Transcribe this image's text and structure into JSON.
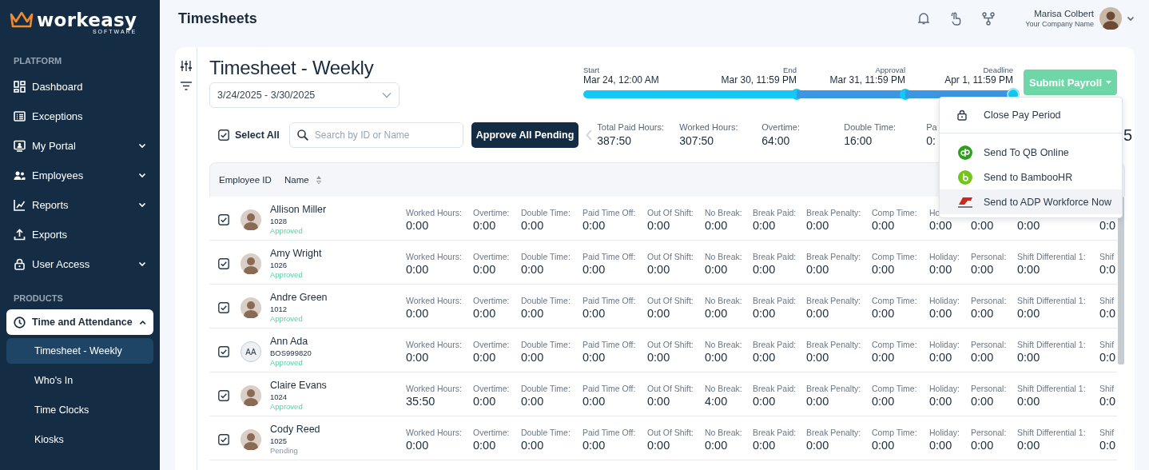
{
  "brand": {
    "name": "workeasy",
    "tagline": "SOFTWARE"
  },
  "sidebar": {
    "sections": [
      {
        "title": "PLATFORM",
        "items": [
          {
            "label": "Dashboard",
            "expandable": false
          },
          {
            "label": "Exceptions",
            "expandable": false
          },
          {
            "label": "My Portal",
            "expandable": true,
            "expanded": false
          },
          {
            "label": "Employees",
            "expandable": true,
            "expanded": false
          },
          {
            "label": "Reports",
            "expandable": true,
            "expanded": false
          },
          {
            "label": "Exports",
            "expandable": false
          },
          {
            "label": "User Access",
            "expandable": true,
            "expanded": false
          }
        ]
      },
      {
        "title": "PRODUCTS",
        "items": [
          {
            "label": "Time and Attendance",
            "expandable": true,
            "expanded": true,
            "children": [
              {
                "label": "Timesheet - Weekly",
                "selected": true
              },
              {
                "label": "Who's In",
                "selected": false
              },
              {
                "label": "Time Clocks",
                "selected": false
              },
              {
                "label": "Kiosks",
                "selected": false
              }
            ]
          }
        ]
      }
    ]
  },
  "header": {
    "title": "Timesheets",
    "user": {
      "name": "Marisa Colbert",
      "company": "Your Company Name"
    }
  },
  "page": {
    "title": "Timesheet - Weekly",
    "date_range": "3/24/2025 - 3/30/2025",
    "timeline": [
      {
        "label": "Start",
        "date": "Mar 24, 12:00 AM"
      },
      {
        "label": "End",
        "date": "Mar 30, 11:59 PM",
        "passed": true,
        "current": false
      },
      {
        "label": "Approval",
        "date": "Mar 31, 11:59 PM",
        "passed": false,
        "current": false
      },
      {
        "label": "Deadline",
        "date": "Apr 1, 11:59 PM",
        "passed": false,
        "current": true
      }
    ],
    "submit_button": "Submit Payroll",
    "menu": [
      {
        "kind": "action",
        "label": "Close Pay Period",
        "highlighted": false
      },
      {
        "kind": "integration",
        "label": "Send To QB Online",
        "highlighted": false
      },
      {
        "kind": "integration",
        "label": "Send to BambooHR",
        "highlighted": false
      },
      {
        "kind": "integration",
        "label": "Send to ADP Workforce Now",
        "highlighted": true
      }
    ],
    "select_all": {
      "label": "Select All",
      "checked": true
    },
    "search": {
      "placeholder": "Search by ID or Name"
    },
    "approve_button": "Approve All Pending",
    "stats": [
      {
        "label": "Total Paid Hours:",
        "value": "387:50"
      },
      {
        "label": "Worked Hours:",
        "value": "307:50"
      },
      {
        "label": "Overtime:",
        "value": "64:00"
      },
      {
        "label": "Double Time:",
        "value": "16:00"
      },
      {
        "label": "Pa",
        "value": "0:"
      }
    ],
    "stats_tail": "5"
  },
  "table": {
    "columns": [
      "Employee ID",
      "Name"
    ],
    "rows": [
      {
        "checked": true,
        "name": "Allison Miller",
        "id": "1028",
        "status": "Approved",
        "approved": true,
        "fields": [
          {
            "label": "Worked Hours:",
            "value": "0:00"
          },
          {
            "label": "Overtime:",
            "value": "0:00"
          },
          {
            "label": "Double Time:",
            "value": "0:00"
          },
          {
            "label": "Paid Time Off:",
            "value": "0:00"
          },
          {
            "label": "Out Of Shift:",
            "value": "0:00"
          },
          {
            "label": "No Break:",
            "value": "0:00"
          },
          {
            "label": "Break Paid:",
            "value": "0:00"
          },
          {
            "label": "Break Penalty:",
            "value": "0:00"
          },
          {
            "label": "Comp Time:",
            "value": "0:00"
          },
          {
            "label": "Ho",
            "value": "0:00"
          },
          {
            "value": "0:00"
          },
          {
            "value": "0:00"
          },
          {
            "value": "0:0"
          }
        ]
      },
      {
        "checked": true,
        "name": "Amy Wright",
        "id": "1026",
        "status": "Approved",
        "approved": true,
        "fields": [
          {
            "label": "Worked Hours:",
            "value": "0:00"
          },
          {
            "label": "Overtime:",
            "value": "0:00"
          },
          {
            "label": "Double Time:",
            "value": "0:00"
          },
          {
            "label": "Paid Time Off:",
            "value": "0:00"
          },
          {
            "label": "Out Of Shift:",
            "value": "0:00"
          },
          {
            "label": "No Break:",
            "value": "0:00"
          },
          {
            "label": "Break Paid:",
            "value": "0:00"
          },
          {
            "label": "Break Penalty:",
            "value": "0:00"
          },
          {
            "label": "Comp Time:",
            "value": "0:00"
          },
          {
            "label": "Holiday:",
            "value": "0:00"
          },
          {
            "label": "Personal:",
            "value": "0:00"
          },
          {
            "label": "Shift Differential 1:",
            "value": "0:00"
          },
          {
            "label": "Shif",
            "value": "0:0"
          }
        ]
      },
      {
        "checked": true,
        "name": "Andre Green",
        "id": "1012",
        "status": "Approved",
        "approved": true,
        "fields": [
          {
            "label": "Worked Hours:",
            "value": "0:00"
          },
          {
            "label": "Overtime:",
            "value": "0:00"
          },
          {
            "label": "Double Time:",
            "value": "0:00"
          },
          {
            "label": "Paid Time Off:",
            "value": "0:00"
          },
          {
            "label": "Out Of Shift:",
            "value": "0:00"
          },
          {
            "label": "No Break:",
            "value": "0:00"
          },
          {
            "label": "Break Paid:",
            "value": "0:00"
          },
          {
            "label": "Break Penalty:",
            "value": "0:00"
          },
          {
            "label": "Comp Time:",
            "value": "0:00"
          },
          {
            "label": "Holiday:",
            "value": "0:00"
          },
          {
            "label": "Personal:",
            "value": "0:00"
          },
          {
            "label": "Shift Differential 1:",
            "value": "0:00"
          },
          {
            "label": "Shif",
            "value": "0:0"
          }
        ]
      },
      {
        "checked": true,
        "name": "Ann Ada",
        "id": "BOS999820",
        "initials": "AA",
        "status": "Approved",
        "approved": true,
        "fields": [
          {
            "label": "Worked Hours:",
            "value": "0:00"
          },
          {
            "label": "Overtime:",
            "value": "0:00"
          },
          {
            "label": "Double Time:",
            "value": "0:00"
          },
          {
            "label": "Paid Time Off:",
            "value": "0:00"
          },
          {
            "label": "Out Of Shift:",
            "value": "0:00"
          },
          {
            "label": "No Break:",
            "value": "0:00"
          },
          {
            "label": "Break Paid:",
            "value": "0:00"
          },
          {
            "label": "Break Penalty:",
            "value": "0:00"
          },
          {
            "label": "Comp Time:",
            "value": "0:00"
          },
          {
            "label": "Holiday:",
            "value": "0:00"
          },
          {
            "label": "Personal:",
            "value": "0:00"
          },
          {
            "label": "Shift Differential 1:",
            "value": "0:00"
          },
          {
            "label": "Shif",
            "value": "0:0"
          }
        ]
      },
      {
        "checked": true,
        "name": "Claire Evans",
        "id": "1024",
        "status": "Approved",
        "approved": true,
        "fields": [
          {
            "label": "Worked Hours:",
            "value": "35:50"
          },
          {
            "label": "Overtime:",
            "value": "0:00"
          },
          {
            "label": "Double Time:",
            "value": "0:00"
          },
          {
            "label": "Paid Time Off:",
            "value": "0:00"
          },
          {
            "label": "Out Of Shift:",
            "value": "0:00"
          },
          {
            "label": "No Break:",
            "value": "4:00"
          },
          {
            "label": "Break Paid:",
            "value": "0:00"
          },
          {
            "label": "Break Penalty:",
            "value": "0:00"
          },
          {
            "label": "Comp Time:",
            "value": "0:00"
          },
          {
            "label": "Holiday:",
            "value": "0:00"
          },
          {
            "label": "Personal:",
            "value": "0:00"
          },
          {
            "label": "Shift Differential 1:",
            "value": "0:00"
          },
          {
            "label": "Shif",
            "value": "0:0"
          }
        ]
      },
      {
        "checked": true,
        "name": "Cody Reed",
        "id": "1025",
        "status": "Pending",
        "approved": false,
        "fields": [
          {
            "label": "Worked Hours:",
            "value": "0:00"
          },
          {
            "label": "Overtime:",
            "value": "0:00"
          },
          {
            "label": "Double Time:",
            "value": "0:00"
          },
          {
            "label": "Paid Time Off:",
            "value": "0:00"
          },
          {
            "label": "Out Of Shift:",
            "value": "0:00"
          },
          {
            "label": "No Break:",
            "value": "0:00"
          },
          {
            "label": "Break Paid:",
            "value": "0:00"
          },
          {
            "label": "Break Penalty:",
            "value": "0:00"
          },
          {
            "label": "Comp Time:",
            "value": "0:00"
          },
          {
            "label": "Holiday:",
            "value": "0:00"
          },
          {
            "label": "Personal:",
            "value": "0:00"
          },
          {
            "label": "Shift Differential 1:",
            "value": "0:00"
          },
          {
            "label": "Shif",
            "value": "0:0"
          }
        ]
      }
    ]
  }
}
